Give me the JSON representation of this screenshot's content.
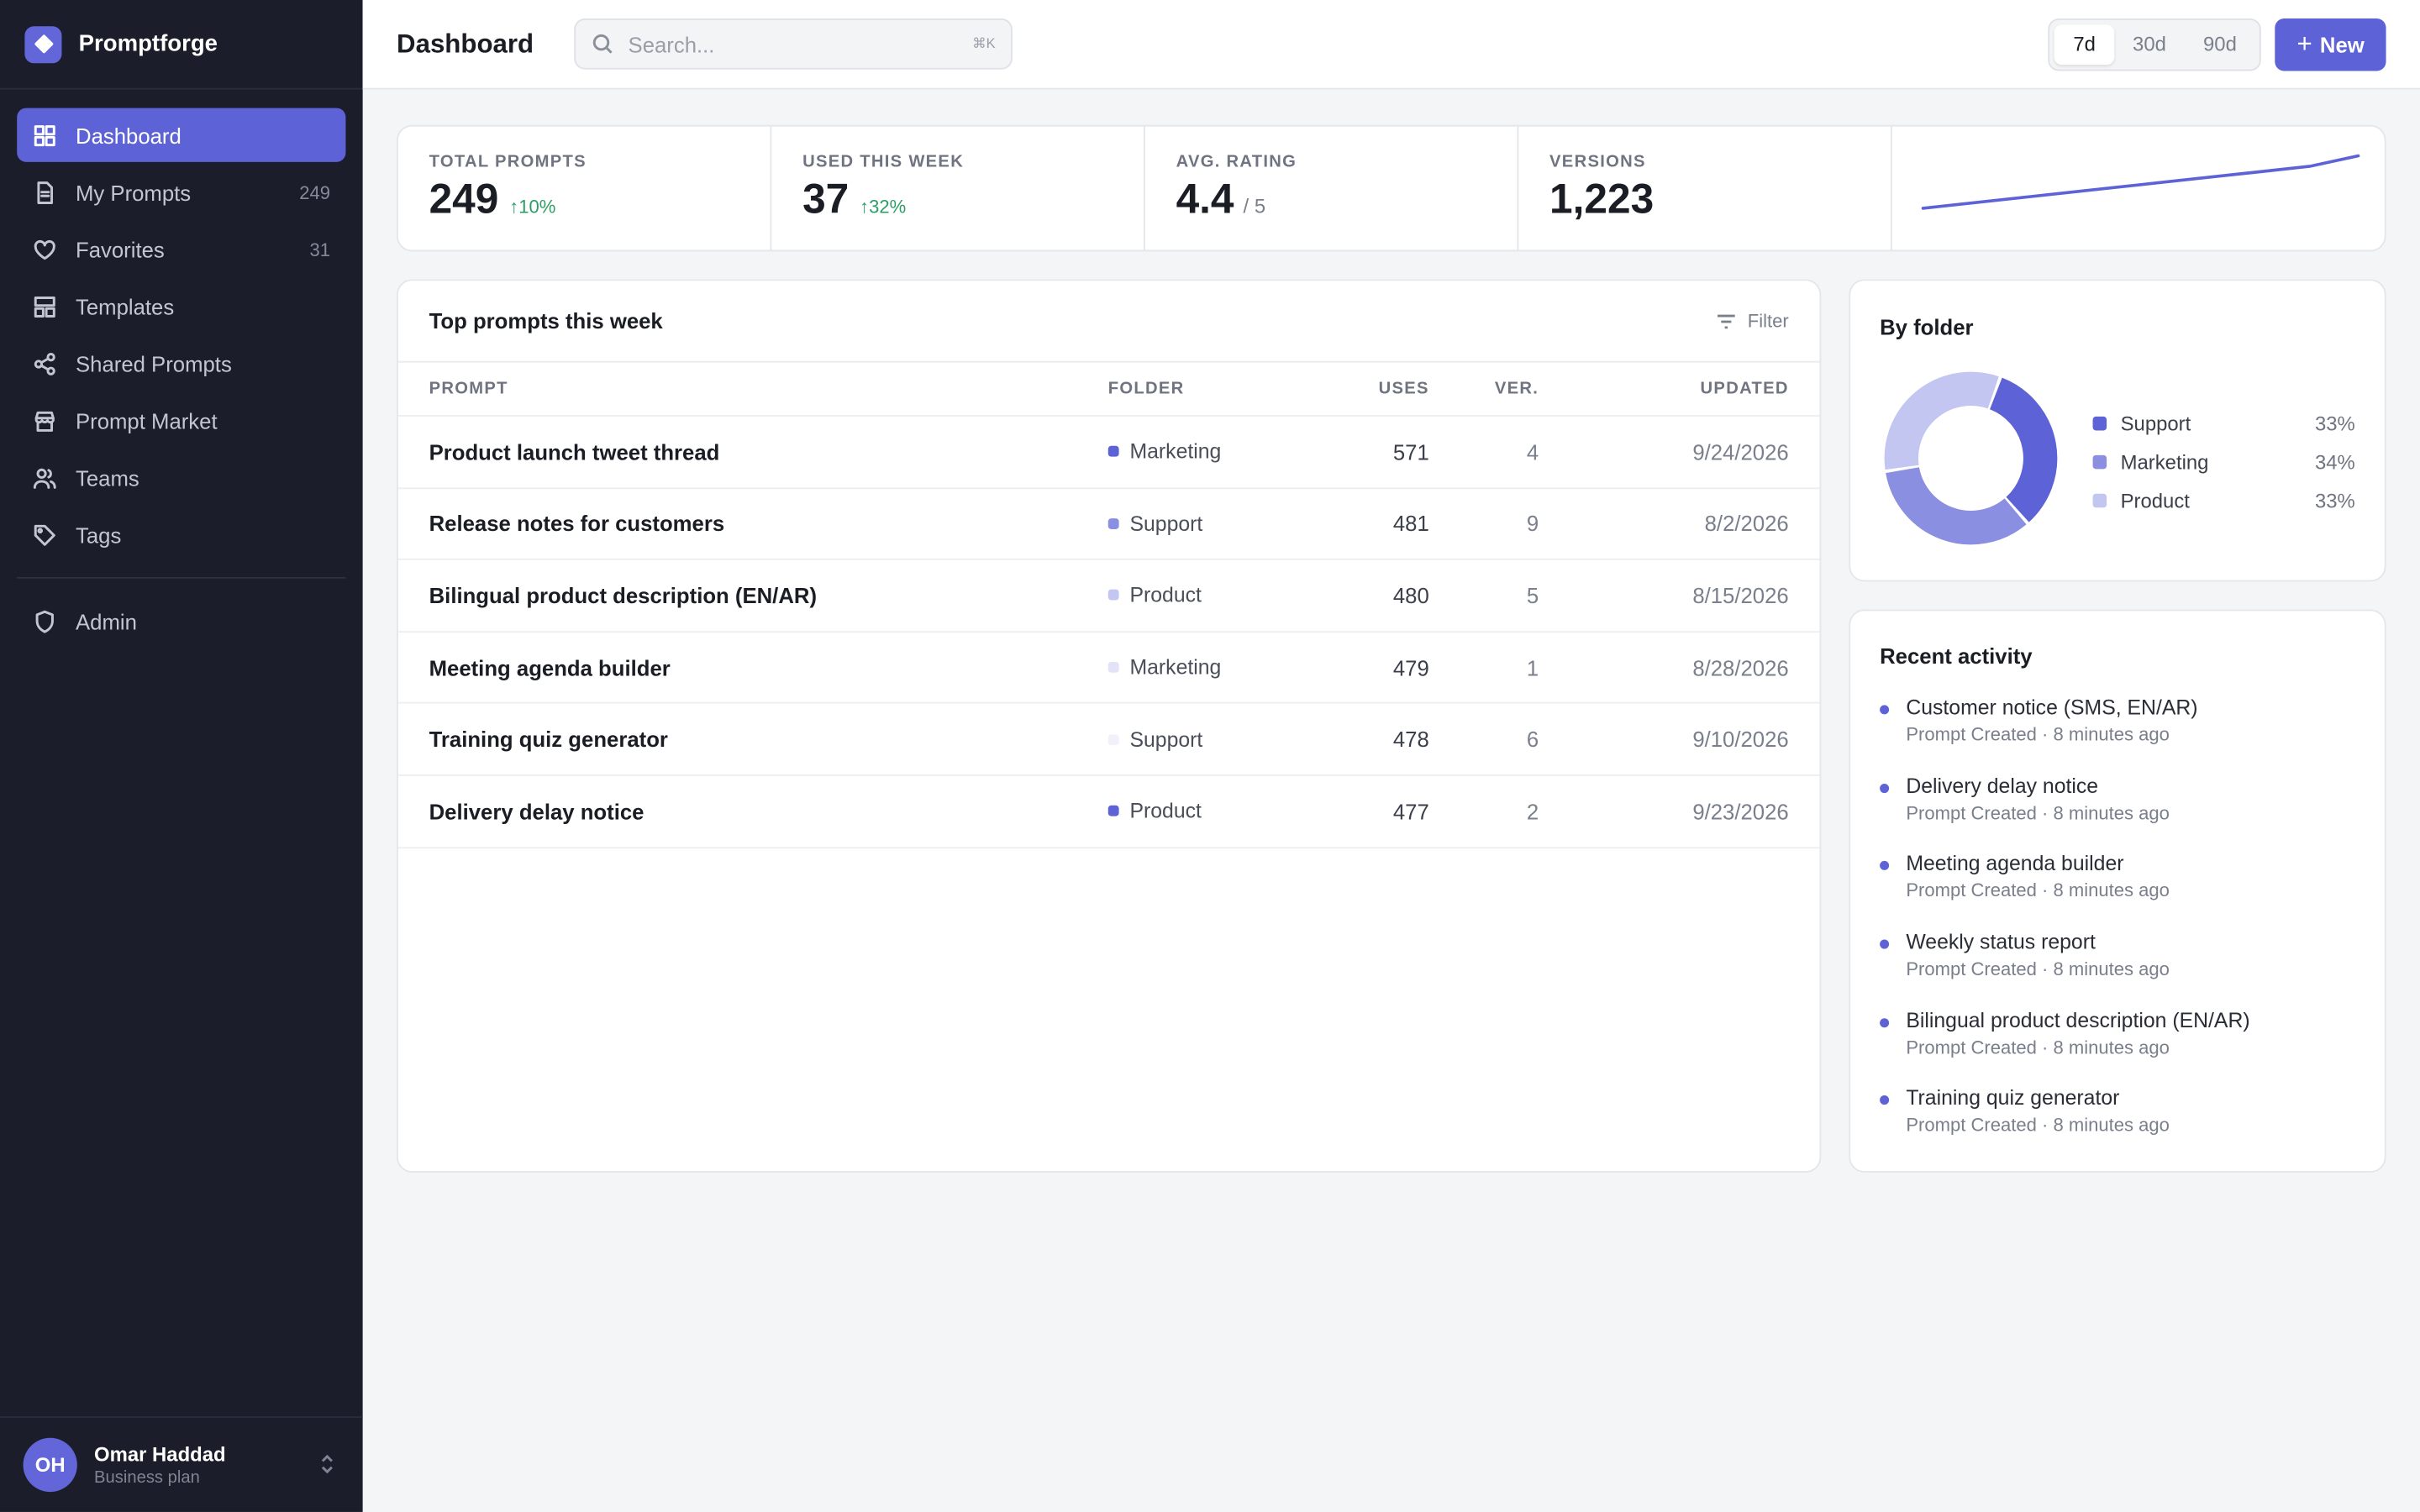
{
  "app": {
    "name": "Promptforge"
  },
  "sidebar": {
    "items": [
      {
        "label": "Dashboard",
        "count": ""
      },
      {
        "label": "My Prompts",
        "count": "249"
      },
      {
        "label": "Favorites",
        "count": "31"
      },
      {
        "label": "Templates",
        "count": ""
      },
      {
        "label": "Shared Prompts",
        "count": ""
      },
      {
        "label": "Prompt Market",
        "count": ""
      },
      {
        "label": "Teams",
        "count": ""
      },
      {
        "label": "Tags",
        "count": ""
      }
    ],
    "admin_label": "Admin"
  },
  "user": {
    "initials": "OH",
    "name": "Omar Haddad",
    "plan": "Business plan"
  },
  "header": {
    "title": "Dashboard",
    "search_placeholder": "Search...",
    "search_shortcut": "⌘K",
    "ranges": [
      "7d",
      "30d",
      "90d"
    ],
    "selected_range": "7d",
    "new_label": "New"
  },
  "stats": [
    {
      "label": "TOTAL PROMPTS",
      "value": "249",
      "delta": "↑10%",
      "suffix": ""
    },
    {
      "label": "USED THIS WEEK",
      "value": "37",
      "delta": "↑32%",
      "suffix": ""
    },
    {
      "label": "AVG. RATING",
      "value": "4.4",
      "delta": "",
      "suffix": "/ 5"
    },
    {
      "label": "VERSIONS",
      "value": "1,223",
      "delta": "",
      "suffix": ""
    }
  ],
  "sparkline": {
    "color": "#5d62d6",
    "values": [
      2,
      3,
      4,
      5,
      6,
      7,
      8,
      9,
      10,
      12
    ]
  },
  "top_prompts": {
    "title": "Top prompts this week",
    "filter_label": "Filter",
    "columns": [
      "PROMPT",
      "FOLDER",
      "USES",
      "VER.",
      "UPDATED"
    ],
    "rows": [
      {
        "prompt": "Product launch tweet thread",
        "folder": "Marketing",
        "folder_color": "#5d62d6",
        "uses": "571",
        "ver": "4",
        "updated": "9/24/2026"
      },
      {
        "prompt": "Release notes for customers",
        "folder": "Support",
        "folder_color": "#8b8fe2",
        "uses": "481",
        "ver": "9",
        "updated": "8/2/2026"
      },
      {
        "prompt": "Bilingual product description (EN/AR)",
        "folder": "Product",
        "folder_color": "#c4c6f2",
        "uses": "480",
        "ver": "5",
        "updated": "8/15/2026"
      },
      {
        "prompt": "Meeting agenda builder",
        "folder": "Marketing",
        "folder_color": "#e2e3f8",
        "uses": "479",
        "ver": "1",
        "updated": "8/28/2026"
      },
      {
        "prompt": "Training quiz generator",
        "folder": "Support",
        "folder_color": "#f0f1fb",
        "uses": "478",
        "ver": "6",
        "updated": "9/10/2026"
      },
      {
        "prompt": "Delivery delay notice",
        "folder": "Product",
        "folder_color": "#5d62d6",
        "uses": "477",
        "ver": "2",
        "updated": "9/23/2026"
      }
    ]
  },
  "by_folder": {
    "title": "By folder",
    "slices": [
      {
        "name": "Support",
        "pct": "33%",
        "value": 33,
        "color": "#5d62d6"
      },
      {
        "name": "Marketing",
        "pct": "34%",
        "value": 34,
        "color": "#8b8fe2"
      },
      {
        "name": "Product",
        "pct": "33%",
        "value": 33,
        "color": "#c4c6f2"
      }
    ]
  },
  "recent_activity": {
    "title": "Recent activity",
    "items": [
      {
        "name": "Customer notice (SMS, EN/AR)",
        "meta": "Prompt Created · 8 minutes ago"
      },
      {
        "name": "Delivery delay notice",
        "meta": "Prompt Created · 8 minutes ago"
      },
      {
        "name": "Meeting agenda builder",
        "meta": "Prompt Created · 8 minutes ago"
      },
      {
        "name": "Weekly status report",
        "meta": "Prompt Created · 8 minutes ago"
      },
      {
        "name": "Bilingual product description (EN/AR)",
        "meta": "Prompt Created · 8 minutes ago"
      },
      {
        "name": "Training quiz generator",
        "meta": "Prompt Created · 8 minutes ago"
      }
    ]
  }
}
